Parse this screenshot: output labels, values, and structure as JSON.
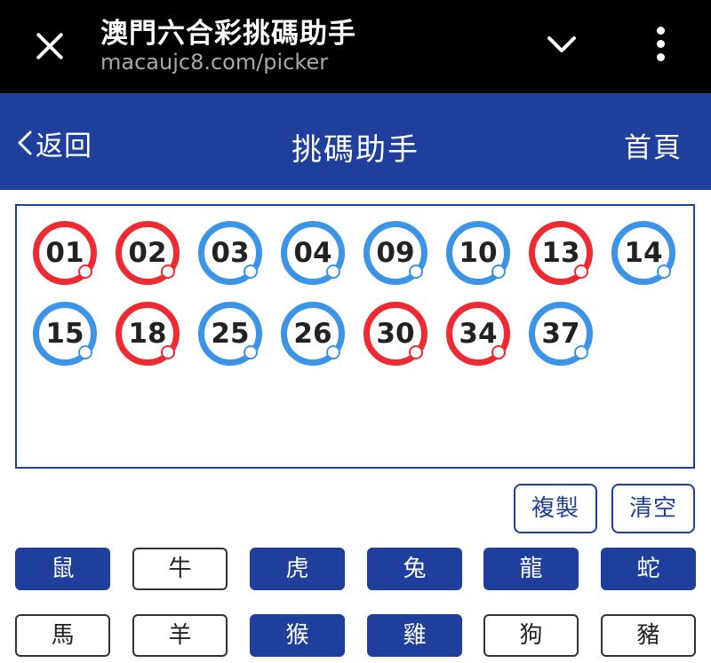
{
  "browser": {
    "title": "澳門六合彩挑碼助手",
    "url": "macaujc8.com/picker"
  },
  "header": {
    "back_label": "返回",
    "title": "挑碼助手",
    "home_label": "首頁"
  },
  "balls": [
    {
      "number": "01",
      "color": "red"
    },
    {
      "number": "02",
      "color": "red"
    },
    {
      "number": "03",
      "color": "blue"
    },
    {
      "number": "04",
      "color": "blue"
    },
    {
      "number": "09",
      "color": "blue"
    },
    {
      "number": "10",
      "color": "blue"
    },
    {
      "number": "13",
      "color": "red"
    },
    {
      "number": "14",
      "color": "blue"
    },
    {
      "number": "15",
      "color": "blue"
    },
    {
      "number": "18",
      "color": "red"
    },
    {
      "number": "25",
      "color": "blue"
    },
    {
      "number": "26",
      "color": "blue"
    },
    {
      "number": "30",
      "color": "red"
    },
    {
      "number": "34",
      "color": "red"
    },
    {
      "number": "37",
      "color": "blue"
    }
  ],
  "actions": {
    "copy_label": "複製",
    "clear_label": "清空"
  },
  "zodiacs": [
    {
      "label": "鼠",
      "selected": true
    },
    {
      "label": "牛",
      "selected": false
    },
    {
      "label": "虎",
      "selected": true
    },
    {
      "label": "兔",
      "selected": true
    },
    {
      "label": "龍",
      "selected": true
    },
    {
      "label": "蛇",
      "selected": true
    },
    {
      "label": "馬",
      "selected": false
    },
    {
      "label": "羊",
      "selected": false
    },
    {
      "label": "猴",
      "selected": true
    },
    {
      "label": "雞",
      "selected": true
    },
    {
      "label": "狗",
      "selected": false
    },
    {
      "label": "豬",
      "selected": false
    }
  ],
  "colors": {
    "brand_blue": "#1e3f9b",
    "ball_red": "#ee2a33",
    "ball_blue": "#3b94e6"
  }
}
